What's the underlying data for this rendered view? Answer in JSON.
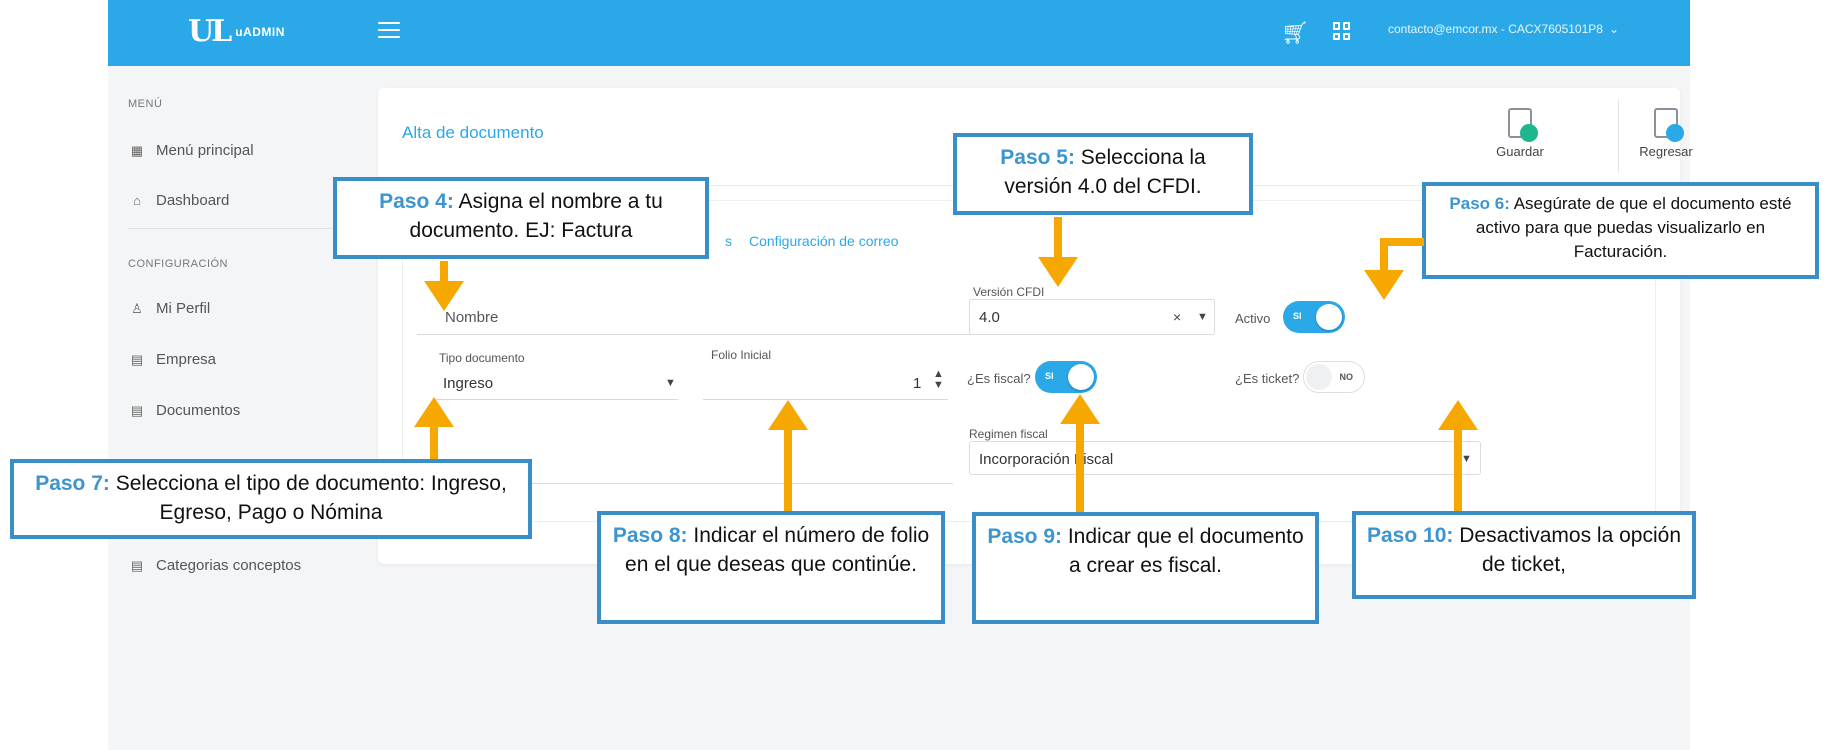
{
  "topbar": {
    "logo_mark": "UL",
    "logo_text": "uADMIN",
    "account": "contacto@emcor.mx - CACX7605101P8",
    "icons": [
      "menu-icon",
      "cart-icon",
      "apps-grid-icon",
      "chevron-down-icon"
    ]
  },
  "sidebar": {
    "menu_heading": "MENÚ",
    "config_heading": "CONFIGURACIÓN",
    "items": [
      {
        "label": "Menú principal",
        "icon": "grid-icon"
      },
      {
        "label": "Dashboard",
        "icon": "home-icon"
      },
      {
        "label": "Mi Perfil",
        "icon": "user-icon"
      },
      {
        "label": "Empresa",
        "icon": "file-icon"
      },
      {
        "label": "Documentos",
        "icon": "file-icon"
      },
      {
        "label": "Categorias conceptos",
        "icon": "file-icon"
      }
    ]
  },
  "card": {
    "title": "Alta de documento",
    "actions": {
      "save": "Guardar",
      "back": "Regresar"
    },
    "tab_partial": "s",
    "tab_email": "Configuración de correo"
  },
  "form": {
    "nombre_placeholder": "Nombre",
    "tipo_label": "Tipo documento",
    "tipo_value": "Ingreso",
    "folio_label": "Folio Inicial",
    "folio_value": "1",
    "version_label": "Versión CFDI",
    "version_value": "4.0",
    "activo_label": "Activo",
    "activo_toggle": "SI",
    "fiscal_label": "¿Es fiscal?",
    "fiscal_toggle": "SI",
    "ticket_label": "¿Es ticket?",
    "ticket_toggle": "NO",
    "regimen_label": "Regimen fiscal",
    "regimen_value": "Incorporación Fiscal"
  },
  "callouts": {
    "p4": {
      "step": "Paso 4:",
      "text": " Asigna el nombre a tu documento. EJ: Factura"
    },
    "p5": {
      "step": "Paso 5:",
      "text": " Selecciona la versión 4.0 del CFDI."
    },
    "p6": {
      "step": "Paso 6:",
      "text": " Asegúrate de que el documento esté activo para que puedas visualizarlo en Facturación."
    },
    "p7": {
      "step": "Paso 7:",
      "text": " Selecciona el tipo de documento: Ingreso, Egreso, Pago o Nómina"
    },
    "p8": {
      "step": "Paso 8:",
      "text": " Indicar el número de folio en el que deseas que continúe."
    },
    "p9": {
      "step": "Paso 9:",
      "text": " Indicar que el documento a crear es fiscal."
    },
    "p10": {
      "step": "Paso 10:",
      "text": " Desactivamos la opción de ticket,"
    }
  },
  "colors": {
    "brand": "#2aa8e8",
    "callout_border": "#3a8ec7",
    "arrow": "#f6a800"
  }
}
